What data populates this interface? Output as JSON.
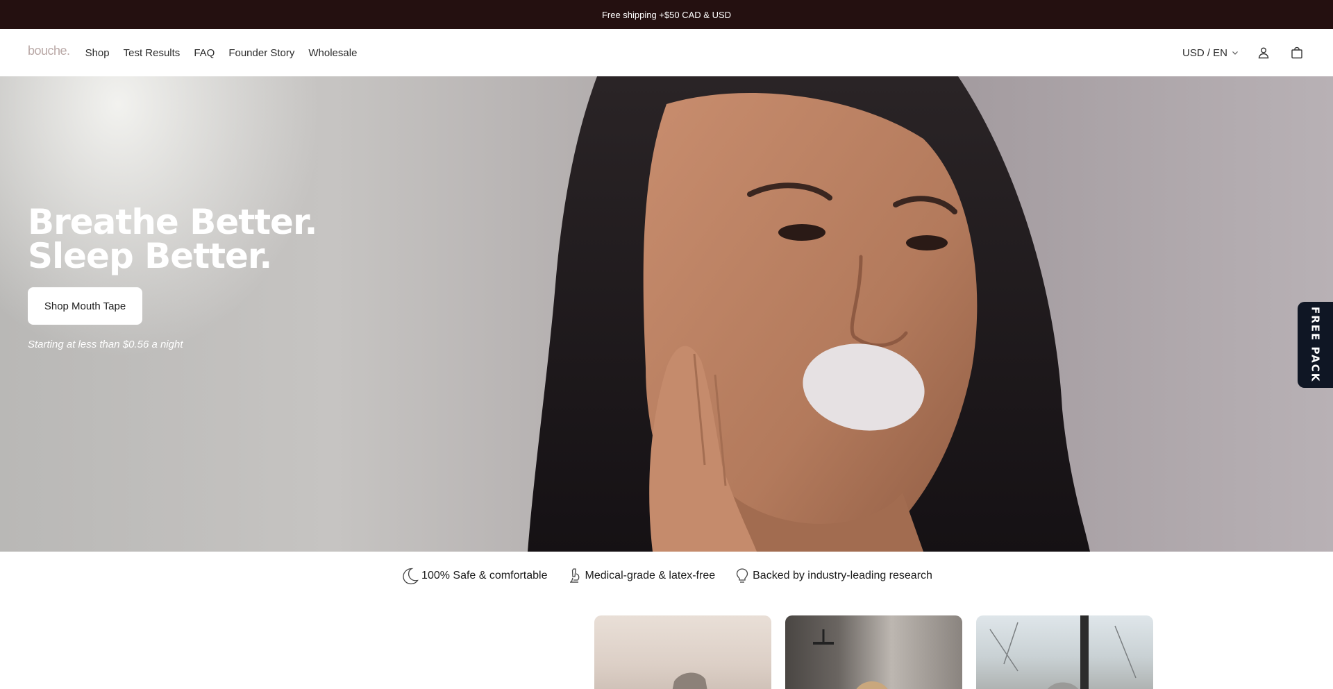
{
  "announcement": {
    "text": "Free shipping +$50 CAD & USD"
  },
  "header": {
    "logo": "bouche.",
    "nav": [
      {
        "label": "Shop"
      },
      {
        "label": "Test Results"
      },
      {
        "label": "FAQ"
      },
      {
        "label": "Founder Story"
      },
      {
        "label": "Wholesale"
      }
    ],
    "currency_label": "USD / EN",
    "icons": {
      "account": "user-icon",
      "cart": "bag-icon",
      "currency": "chevron-down-icon"
    }
  },
  "hero": {
    "title_line1": "Breathe Better.",
    "title_line2": "Sleep Better.",
    "button_label": "Shop Mouth Tape",
    "note": "Starting at less than $0.56 a night"
  },
  "side_tab": {
    "label": "FREE PACK"
  },
  "features": [
    {
      "icon": "moon-icon",
      "label": "100% Safe & comfortable"
    },
    {
      "icon": "microscope-icon",
      "label": "Medical-grade & latex-free"
    },
    {
      "icon": "lightbulb-icon",
      "label": "Backed by industry-leading research"
    }
  ],
  "colors": {
    "announcement_bg": "#241010",
    "side_tab_bg": "#0f1624",
    "logo": "#b9a8a6"
  }
}
